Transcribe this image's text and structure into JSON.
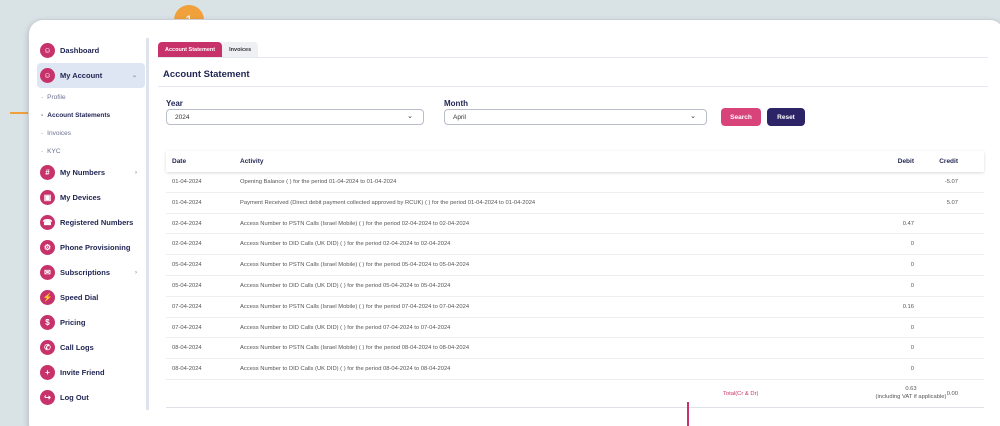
{
  "annotation": {
    "badge_number": "1"
  },
  "sidebar": {
    "items": [
      {
        "label": "Dashboard",
        "icon": "☺"
      },
      {
        "label": "My Account",
        "icon": "☺",
        "chevron": "⌄"
      },
      {
        "label": "My Numbers",
        "icon": "#",
        "chevron": "›"
      },
      {
        "label": "My Devices",
        "icon": "▣"
      },
      {
        "label": "Registered Numbers",
        "icon": "☎"
      },
      {
        "label": "Phone Provisioning",
        "icon": "⚙"
      },
      {
        "label": "Subscriptions",
        "icon": "✉",
        "chevron": "›"
      },
      {
        "label": "Speed Dial",
        "icon": "⚡"
      },
      {
        "label": "Pricing",
        "icon": "$"
      },
      {
        "label": "Call Logs",
        "icon": "✆"
      },
      {
        "label": "Invite Friend",
        "icon": "+"
      },
      {
        "label": "Log Out",
        "icon": "↪"
      }
    ],
    "subitems": [
      {
        "label": "Profile"
      },
      {
        "label": "Account Statements"
      },
      {
        "label": "Invoices"
      },
      {
        "label": "KYC"
      }
    ]
  },
  "tabs": [
    {
      "label": "Account Statement"
    },
    {
      "label": "Invoices"
    }
  ],
  "page": {
    "title": "Account Statement"
  },
  "filters": {
    "year_label": "Year",
    "year_value": "2024",
    "month_label": "Month",
    "month_value": "April",
    "search_label": "Search",
    "reset_label": "Reset"
  },
  "table": {
    "headers": {
      "date": "Date",
      "activity": "Activity",
      "debit": "Debit",
      "credit": "Credit"
    },
    "rows": [
      {
        "date": "01-04-2024",
        "activity": "Opening Balance ( ) for the period 01-04-2024 to 01-04-2024",
        "debit": "",
        "credit": "-5.07"
      },
      {
        "date": "01-04-2024",
        "activity": "Payment Received (Direct debit payment collected approved by RCUK) ( ) for the period 01-04-2024 to 01-04-2024",
        "debit": "",
        "credit": "5.07"
      },
      {
        "date": "02-04-2024",
        "activity": "Access Number to PSTN Calls (Israel Mobile) ( ) for the period 02-04-2024 to 02-04-2024",
        "debit": "0.47",
        "credit": ""
      },
      {
        "date": "02-04-2024",
        "activity": "Access Number to DID Calls (UK DID) ( ) for the period 02-04-2024 to 02-04-2024",
        "debit": "0",
        "credit": ""
      },
      {
        "date": "05-04-2024",
        "activity": "Access Number to PSTN Calls (Israel Mobile) ( ) for the period 05-04-2024 to 05-04-2024",
        "debit": "0",
        "credit": ""
      },
      {
        "date": "05-04-2024",
        "activity": "Access Number to DID Calls (UK DID) ( ) for the period 05-04-2024 to 05-04-2024",
        "debit": "0",
        "credit": ""
      },
      {
        "date": "07-04-2024",
        "activity": "Access Number to PSTN Calls (Israel Mobile) ( ) for the period 07-04-2024 to 07-04-2024",
        "debit": "0.16",
        "credit": ""
      },
      {
        "date": "07-04-2024",
        "activity": "Access Number to DID Calls (UK DID) ( ) for the period 07-04-2024 to 07-04-2024",
        "debit": "0",
        "credit": ""
      },
      {
        "date": "08-04-2024",
        "activity": "Access Number to PSTN Calls (Israel Mobile) ( ) for the period 08-04-2024 to 08-04-2024",
        "debit": "0",
        "credit": ""
      },
      {
        "date": "08-04-2024",
        "activity": "Access Number to DID Calls (UK DID) ( ) for the period 08-04-2024 to 08-04-2024",
        "debit": "0",
        "credit": ""
      }
    ],
    "total": {
      "label": "Total(Cr & Dr)",
      "debit": "0.63",
      "vat_note": "(including VAT if applicable)",
      "credit": "0.00"
    }
  },
  "colors": {
    "accent": "#c8326a",
    "navy": "#2c2466",
    "badge": "#f0a13c"
  }
}
